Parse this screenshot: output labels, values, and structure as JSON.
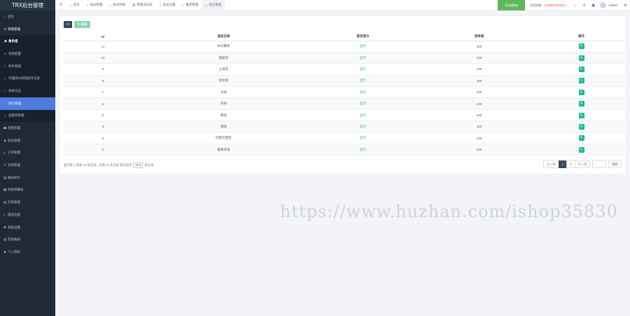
{
  "app": {
    "title": "TRX后台管理"
  },
  "sidebar": {
    "items": [
      {
        "label": "首页",
        "icon": "home-icon",
        "glyph": "⌂"
      },
      {
        "label": "常规管理",
        "icon": "gear-icon",
        "glyph": "⚙",
        "expanded": true
      },
      {
        "label": "角色组",
        "icon": "users-icon",
        "glyph": "☗"
      },
      {
        "label": "系统配置",
        "icon": "list-icon",
        "glyph": "≡"
      },
      {
        "label": "附件管理",
        "icon": "circle-icon",
        "glyph": "○"
      },
      {
        "label": "代理商ID权限操作记录",
        "icon": "circle-icon",
        "glyph": "○"
      },
      {
        "label": "系统日志",
        "icon": "circle-icon",
        "glyph": "○"
      },
      {
        "label": "语言管理",
        "icon": "circle-icon",
        "glyph": "○",
        "active": true
      },
      {
        "label": "运营商管理",
        "icon": "circle-icon",
        "glyph": "○"
      },
      {
        "label": "权限管理",
        "icon": "users-icon",
        "glyph": "☗"
      },
      {
        "label": "会员管理",
        "icon": "user-icon",
        "glyph": "♟"
      },
      {
        "label": "订单管理",
        "icon": "list-icon",
        "glyph": "≡"
      },
      {
        "label": "充提管理",
        "icon": "edit-icon",
        "glyph": "✎"
      },
      {
        "label": "报表统计",
        "icon": "chart-icon",
        "glyph": "▤"
      },
      {
        "label": "资金明细表",
        "icon": "table-icon",
        "glyph": "▦"
      },
      {
        "label": "交易管理",
        "icon": "table-icon",
        "glyph": "▤"
      },
      {
        "label": "筛选功能",
        "icon": "search-icon",
        "glyph": "⌕"
      },
      {
        "label": "系统设置",
        "icon": "wrench-icon",
        "glyph": "✱"
      },
      {
        "label": "充值通道",
        "icon": "money-icon",
        "glyph": "▥"
      },
      {
        "label": "个人资料",
        "icon": "user-icon",
        "glyph": "♟"
      }
    ]
  },
  "topbar": {
    "tabs": [
      {
        "label": "首页",
        "glyph": "⌂"
      },
      {
        "label": "会员管理",
        "glyph": "○"
      },
      {
        "label": "会员列表",
        "glyph": "○"
      },
      {
        "label": "管理员日志",
        "glyph": "▤"
      },
      {
        "label": "会员设置",
        "glyph": "○"
      },
      {
        "label": "推荐管理",
        "glyph": "○"
      },
      {
        "label": "语言管理",
        "glyph": "○",
        "active": true
      }
    ],
    "capture_button": "补充通知8",
    "balance_label": "可用余额：",
    "balance_value": "( 99999.000000 )",
    "admin_name": "Admin"
  },
  "toolbar": {
    "refresh_glyph": "⟳",
    "edit_label": "✎ 编辑"
  },
  "table": {
    "headers": [
      "Id",
      "语言名称",
      "是否显示",
      "排序值",
      "操作"
    ],
    "rows": [
      {
        "id": "11",
        "name": "中文繁体",
        "status": "显示",
        "sort": "100"
      },
      {
        "id": "10",
        "name": "西班牙",
        "status": "显示",
        "sort": "100"
      },
      {
        "id": "9",
        "name": "土耳其",
        "status": "显示",
        "sort": "100"
      },
      {
        "id": "8",
        "name": "阿拉伯",
        "status": "显示",
        "sort": "100"
      },
      {
        "id": "7",
        "name": "法语",
        "status": "显示",
        "sort": "100"
      },
      {
        "id": "6",
        "name": "日本",
        "status": "显示",
        "sort": "100"
      },
      {
        "id": "5",
        "name": "韩语",
        "status": "显示",
        "sort": "100"
      },
      {
        "id": "4",
        "name": "俄语",
        "status": "显示",
        "sort": "100"
      },
      {
        "id": "3",
        "name": "印度尼西亚",
        "status": "显示",
        "sort": "100"
      },
      {
        "id": "2",
        "name": "葡萄牙语",
        "status": "显示",
        "sort": "100"
      }
    ]
  },
  "footer": {
    "info_prefix": "显示第 1 到第 10 条记录，总共 11 条记录 每页显示",
    "page_size": "10 ▾",
    "info_suffix": "条记录",
    "prev": "上一页",
    "pages": [
      "1",
      "2"
    ],
    "next": "下一页",
    "go": "跳转"
  },
  "watermark": "https://www.huzhan.com/ishop35830",
  "colors": {
    "sidebar": "#1f2a35",
    "active": "#4f7ddd",
    "success": "#5cb85c",
    "accent": "#1abc9c"
  }
}
